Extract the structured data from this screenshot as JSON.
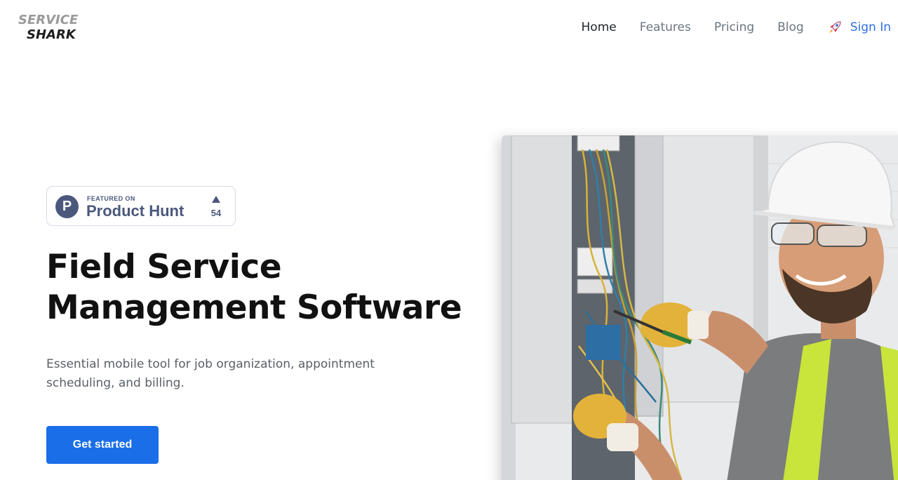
{
  "brand": {
    "line1": "SERVICE",
    "line2": "SHARK"
  },
  "nav": {
    "items": [
      {
        "label": "Home",
        "active": true
      },
      {
        "label": "Features",
        "active": false
      },
      {
        "label": "Pricing",
        "active": false
      },
      {
        "label": "Blog",
        "active": false
      }
    ],
    "signin": {
      "label": "Sign In",
      "icon": "rocket-icon"
    }
  },
  "badge": {
    "letter": "P",
    "featured": "FEATURED ON",
    "name": "Product Hunt",
    "count": "54",
    "icon": "upvote-triangle-icon"
  },
  "hero": {
    "title_line1": "Field Service",
    "title_line2": "Management Software",
    "subtitle": "Essential mobile tool for job organization, appointment scheduling, and billing.",
    "cta": "Get started",
    "image": "electrician-working-on-panel-photo"
  },
  "colors": {
    "primary": "#1a6ee8",
    "link": "#2f6fe4",
    "product_hunt": "#4b587c",
    "nav_text": "#6c757d",
    "heading": "#111111"
  }
}
